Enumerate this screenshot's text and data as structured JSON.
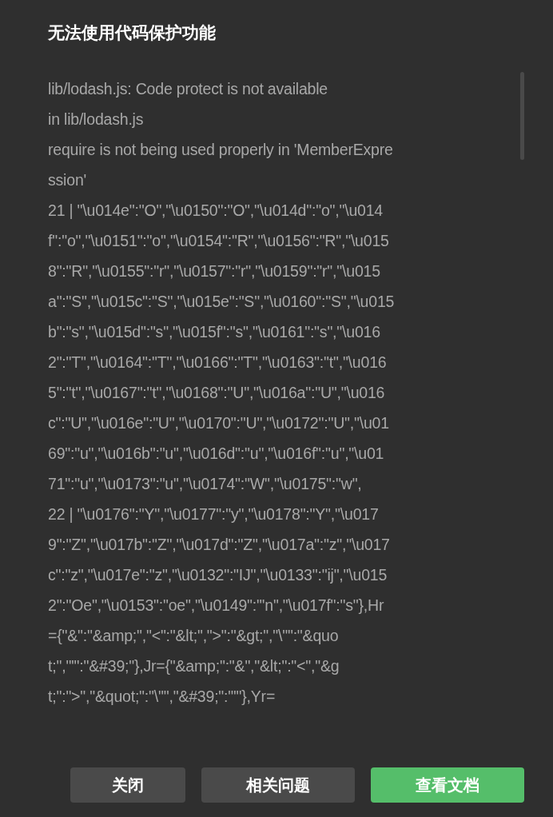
{
  "dialog": {
    "title": "无法使用代码保护功能",
    "log_lines": [
      "lib/lodash.js: Code protect is not available",
      "in lib/lodash.js",
      "require is not being used properly in 'MemberExpre",
      "ssion'",
      "21 | \"\\u014e\":\"O\",\"\\u0150\":\"O\",\"\\u014d\":\"o\",\"\\u014",
      "f\":\"o\",\"\\u0151\":\"o\",\"\\u0154\":\"R\",\"\\u0156\":\"R\",\"\\u015",
      "8\":\"R\",\"\\u0155\":\"r\",\"\\u0157\":\"r\",\"\\u0159\":\"r\",\"\\u015",
      "a\":\"S\",\"\\u015c\":\"S\",\"\\u015e\":\"S\",\"\\u0160\":\"S\",\"\\u015",
      "b\":\"s\",\"\\u015d\":\"s\",\"\\u015f\":\"s\",\"\\u0161\":\"s\",\"\\u016",
      "2\":\"T\",\"\\u0164\":\"T\",\"\\u0166\":\"T\",\"\\u0163\":\"t\",\"\\u016",
      "5\":\"t\",\"\\u0167\":\"t\",\"\\u0168\":\"U\",\"\\u016a\":\"U\",\"\\u016",
      "c\":\"U\",\"\\u016e\":\"U\",\"\\u0170\":\"U\",\"\\u0172\":\"U\",\"\\u01",
      "69\":\"u\",\"\\u016b\":\"u\",\"\\u016d\":\"u\",\"\\u016f\":\"u\",\"\\u01",
      "71\":\"u\",\"\\u0173\":\"u\",\"\\u0174\":\"W\",\"\\u0175\":\"w\",",
      "22 | \"\\u0176\":\"Y\",\"\\u0177\":\"y\",\"\\u0178\":\"Y\",\"\\u017",
      "9\":\"Z\",\"\\u017b\":\"Z\",\"\\u017d\":\"Z\",\"\\u017a\":\"z\",\"\\u017",
      "c\":\"z\",\"\\u017e\":\"z\",\"\\u0132\":\"IJ\",\"\\u0133\":\"ij\",\"\\u015",
      "2\":\"Oe\",\"\\u0153\":\"oe\",\"\\u0149\":\"'n\",\"\\u017f\":\"s\"},Hr",
      "={\"&\":\"&amp;\",\"<\":\"&lt;\",\">\":\"&gt;\",\"\\\"\":\"&quo",
      "t;\",\"'\":\"&#39;\"},Jr={\"&amp;\":\"&\",\"&lt;\":\"<\",\"&g",
      "t;\":\">\",\"&quot;\":\"\\\"\",\"&#39;\":\"'\"},Yr="
    ],
    "buttons": [
      {
        "label": "关闭",
        "kind": "secondary"
      },
      {
        "label": "相关问题",
        "kind": "secondary"
      },
      {
        "label": "查看文档",
        "kind": "primary"
      }
    ]
  }
}
